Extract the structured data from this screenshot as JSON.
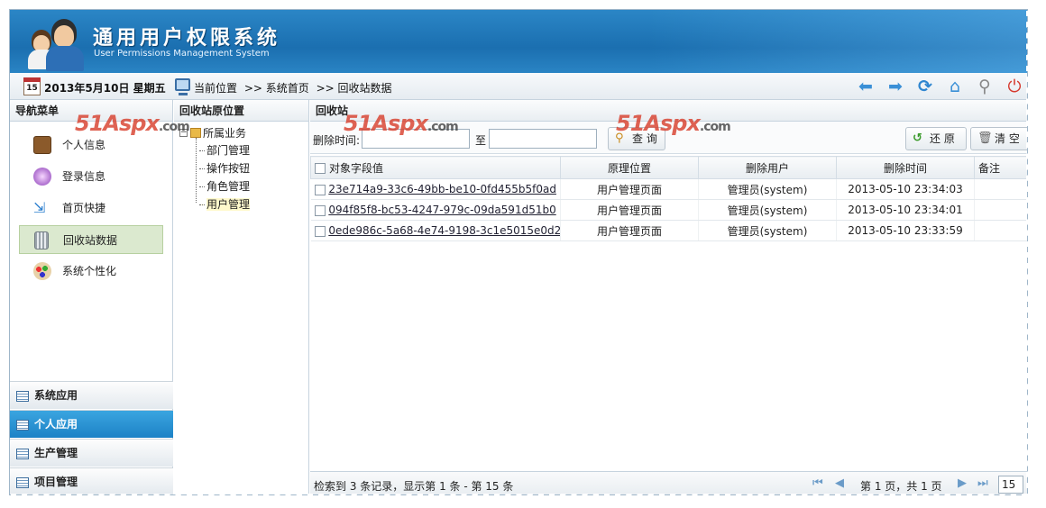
{
  "header": {
    "title": "通用用户权限系统",
    "subtitle": "User Permissions Management System"
  },
  "topbar": {
    "cal_day": "15",
    "date": "2013年5月10日 星期五",
    "location_label": "当前位置",
    "crumb_1": ">> 系统首页",
    "crumb_2": ">> 回收站数据"
  },
  "nav": {
    "title": "导航菜单",
    "items": [
      {
        "label": "个人信息",
        "icon": "briefcase-icon"
      },
      {
        "label": "登录信息",
        "icon": "lightbulb-icon"
      },
      {
        "label": "首页快捷",
        "icon": "shortcut-arrows-icon"
      },
      {
        "label": "回收站数据",
        "icon": "trash-bin-icon"
      },
      {
        "label": "系统个性化",
        "icon": "palette-icon"
      }
    ],
    "accordion": [
      {
        "label": "系统应用"
      },
      {
        "label": "个人应用"
      },
      {
        "label": "生产管理"
      },
      {
        "label": "项目管理"
      }
    ]
  },
  "tree": {
    "title": "回收站原位置",
    "root": "所属业务",
    "nodes": [
      "部门管理",
      "操作按钮",
      "角色管理",
      "用户管理"
    ]
  },
  "main": {
    "title": "回收站",
    "delete_time_label": "删除时间:",
    "to_label": "至",
    "query_button": "查 询",
    "restore_button": "还 原",
    "clear_button": "清 空",
    "columns": [
      "对象字段值",
      "原理位置",
      "删除用户",
      "删除时间",
      "备注"
    ],
    "rows": [
      {
        "value": "23e714a9-33c6-49bb-be10-0fd455b5f0ad",
        "location": "用户管理页面",
        "user": "管理员(system)",
        "time": "2013-05-10 23:34:03",
        "note": ""
      },
      {
        "value": "094f85f8-bc53-4247-979c-09da591d51b0",
        "location": "用户管理页面",
        "user": "管理员(system)",
        "time": "2013-05-10 23:34:01",
        "note": ""
      },
      {
        "value": "0ede986c-5a68-4e74-9198-3c1e5015e0d2",
        "location": "用户管理页面",
        "user": "管理员(system)",
        "time": "2013-05-10 23:33:59",
        "note": ""
      }
    ],
    "pager_summary": "检索到 3 条记录，显示第 1 条 - 第 15 条",
    "pager_page": "第 1 页，共 1 页",
    "page_size": "15"
  },
  "watermark": {
    "text": "51Aspx",
    "suffix": ".com"
  }
}
